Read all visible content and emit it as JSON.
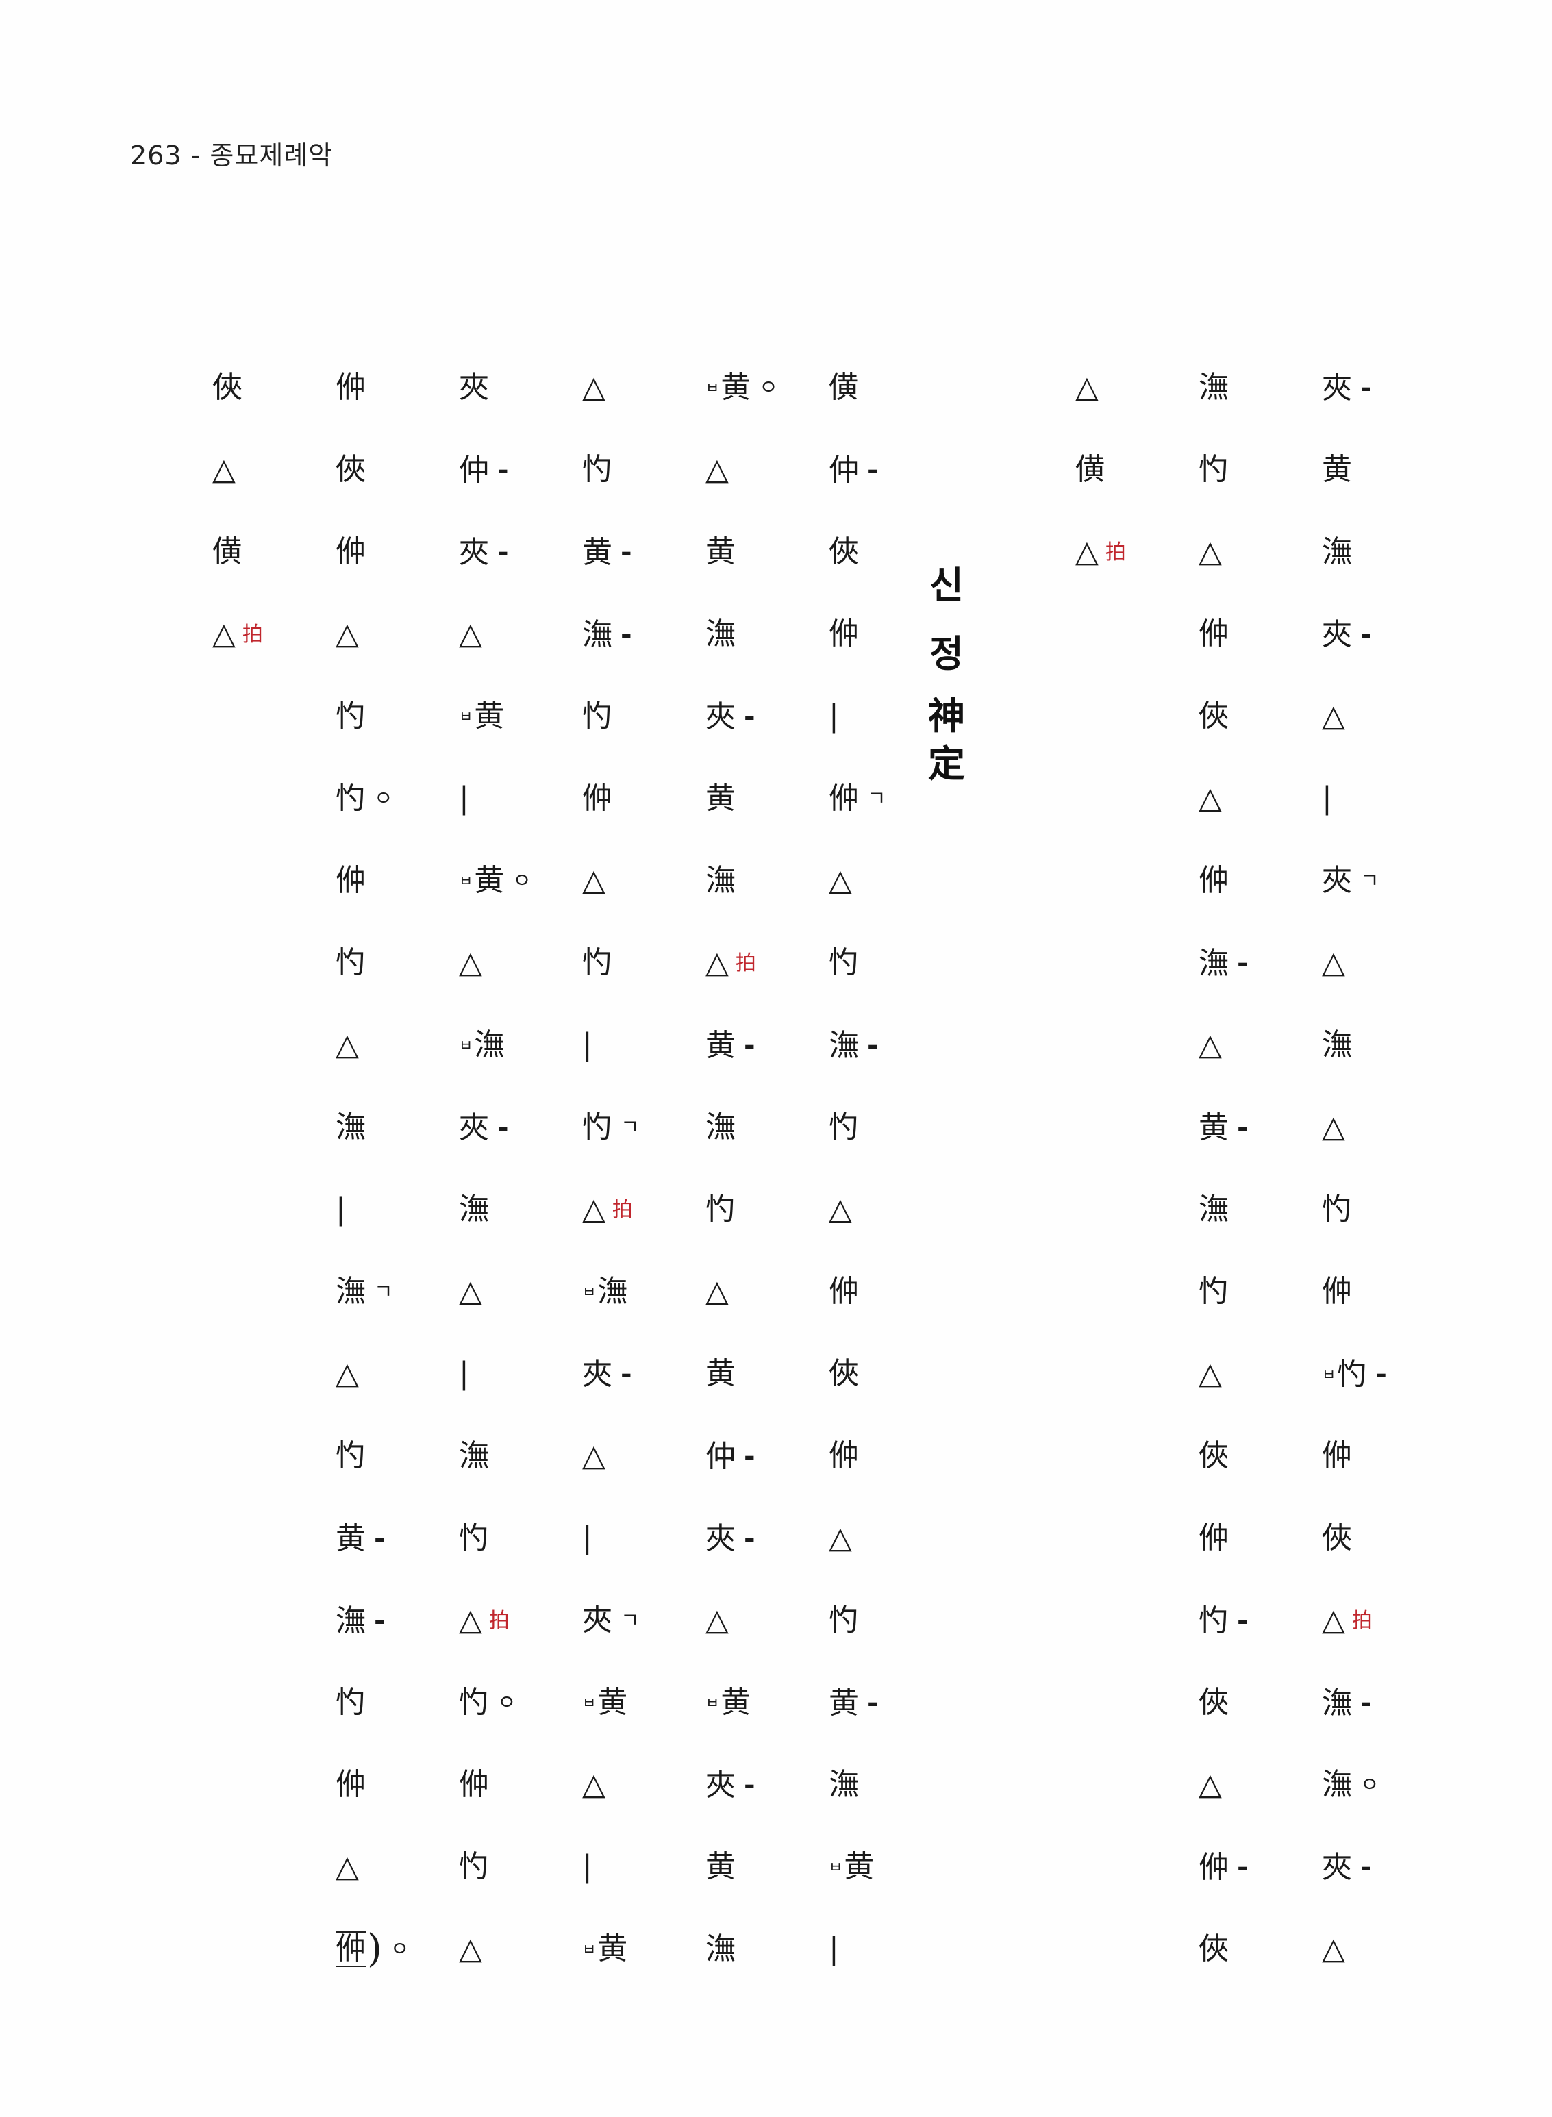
{
  "header": {
    "text": "263 - 종묘제례악"
  },
  "title": {
    "korean": [
      "신",
      "정"
    ],
    "hanja": [
      "神",
      "定"
    ]
  },
  "columns": [
    {
      "cells": [
        {
          "c": "俠"
        },
        {
          "c": "△"
        },
        {
          "c": "僙"
        },
        {
          "c": "△",
          "k": "拍"
        }
      ]
    },
    {
      "cells": [
        {
          "c": "㑖"
        },
        {
          "c": "俠"
        },
        {
          "c": "㑖"
        },
        {
          "c": "△"
        },
        {
          "c": "㣿"
        },
        {
          "c": "㣿",
          "s": "ㅇ"
        },
        {
          "c": "㑖"
        },
        {
          "c": "㣿"
        },
        {
          "c": "△"
        },
        {
          "c": "潕"
        },
        {
          "c": "|"
        },
        {
          "c": "潕",
          "s": "ㄱ"
        },
        {
          "c": "△"
        },
        {
          "c": "㣿"
        },
        {
          "c": "黄",
          "s": "-"
        },
        {
          "c": "潕",
          "s": "-"
        },
        {
          "c": "㣿"
        },
        {
          "c": "㑖"
        },
        {
          "c": "△"
        },
        {
          "c": "㑖",
          "m": true,
          "s": "ㅇ"
        }
      ]
    },
    {
      "cells": [
        {
          "c": "夾"
        },
        {
          "c": "仲",
          "s": "-"
        },
        {
          "c": "夾",
          "s": "-"
        },
        {
          "c": "△"
        },
        {
          "c": "黄",
          "p": "ㅂ"
        },
        {
          "c": "|"
        },
        {
          "c": "黄",
          "p": "ㅂ",
          "s": "ㅇ"
        },
        {
          "c": "△"
        },
        {
          "c": "潕",
          "p": "ㅂ"
        },
        {
          "c": "夾",
          "s": "-"
        },
        {
          "c": "潕"
        },
        {
          "c": "△"
        },
        {
          "c": "|"
        },
        {
          "c": "潕"
        },
        {
          "c": "㣿"
        },
        {
          "c": "△",
          "k": "拍"
        },
        {
          "c": "㣿",
          "s": "ㅇ"
        },
        {
          "c": "㑖"
        },
        {
          "c": "㣿"
        },
        {
          "c": "△"
        }
      ]
    },
    {
      "cells": [
        {
          "c": "△"
        },
        {
          "c": "㣿"
        },
        {
          "c": "黄",
          "s": "-"
        },
        {
          "c": "潕",
          "s": "-"
        },
        {
          "c": "㣿"
        },
        {
          "c": "㑖"
        },
        {
          "c": "△"
        },
        {
          "c": "㣿"
        },
        {
          "c": "|"
        },
        {
          "c": "㣿",
          "s": "ㄱ"
        },
        {
          "c": "△",
          "k": "拍"
        },
        {
          "c": "潕",
          "p": "ㅂ"
        },
        {
          "c": "夾",
          "s": "-"
        },
        {
          "c": "△"
        },
        {
          "c": "|"
        },
        {
          "c": "夾",
          "s": "ㄱ"
        },
        {
          "c": "黄",
          "p": "ㅂ"
        },
        {
          "c": "△"
        },
        {
          "c": "|"
        },
        {
          "c": "黄",
          "p": "ㅂ"
        }
      ]
    },
    {
      "cells": [
        {
          "c": "黄",
          "p": "ㅂ",
          "s": "ㅇ"
        },
        {
          "c": "△"
        },
        {
          "c": "黄"
        },
        {
          "c": "潕"
        },
        {
          "c": "夾",
          "s": "-"
        },
        {
          "c": "黄"
        },
        {
          "c": "潕"
        },
        {
          "c": "△",
          "k": "拍"
        },
        {
          "c": "黄",
          "s": "-"
        },
        {
          "c": "潕"
        },
        {
          "c": "㣿"
        },
        {
          "c": "△"
        },
        {
          "c": "黄"
        },
        {
          "c": "仲",
          "s": "-"
        },
        {
          "c": "夾",
          "s": "-"
        },
        {
          "c": "△"
        },
        {
          "c": "黄",
          "p": "ㅂ"
        },
        {
          "c": "夾",
          "s": "-"
        },
        {
          "c": "黄"
        },
        {
          "c": "潕"
        }
      ]
    },
    {
      "cells": [
        {
          "c": "僙"
        },
        {
          "c": "仲",
          "s": "-"
        },
        {
          "c": "俠"
        },
        {
          "c": "㑖"
        },
        {
          "c": "|"
        },
        {
          "c": "㑖",
          "s": "ㄱ"
        },
        {
          "c": "△"
        },
        {
          "c": "㣿"
        },
        {
          "c": "潕",
          "s": "-"
        },
        {
          "c": "㣿"
        },
        {
          "c": "△"
        },
        {
          "c": "㑖"
        },
        {
          "c": "俠"
        },
        {
          "c": "㑖"
        },
        {
          "c": "△"
        },
        {
          "c": "㣿"
        },
        {
          "c": "黄",
          "s": "-"
        },
        {
          "c": "潕"
        },
        {
          "c": "黄",
          "p": "ㅂ"
        },
        {
          "c": "|"
        }
      ]
    },
    {
      "cells": [
        {
          "c": "△"
        },
        {
          "c": "僙"
        },
        {
          "c": "△",
          "k": "拍"
        }
      ]
    },
    {
      "cells": [
        {
          "c": "潕"
        },
        {
          "c": "㣿"
        },
        {
          "c": "△"
        },
        {
          "c": "㑖"
        },
        {
          "c": "俠"
        },
        {
          "c": "△"
        },
        {
          "c": "㑖"
        },
        {
          "c": "潕",
          "s": "-"
        },
        {
          "c": "△"
        },
        {
          "c": "黄",
          "s": "-"
        },
        {
          "c": "潕"
        },
        {
          "c": "㣿"
        },
        {
          "c": "△"
        },
        {
          "c": "俠"
        },
        {
          "c": "㑖"
        },
        {
          "c": "㣿",
          "s": "-"
        },
        {
          "c": "俠"
        },
        {
          "c": "△"
        },
        {
          "c": "㑖",
          "s": "-"
        },
        {
          "c": "俠"
        }
      ]
    },
    {
      "cells": [
        {
          "c": "夾",
          "s": "-"
        },
        {
          "c": "黄"
        },
        {
          "c": "潕"
        },
        {
          "c": "夾",
          "s": "-"
        },
        {
          "c": "△"
        },
        {
          "c": "|"
        },
        {
          "c": "夾",
          "s": "ㄱ"
        },
        {
          "c": "△"
        },
        {
          "c": "潕"
        },
        {
          "c": "△"
        },
        {
          "c": "㣿"
        },
        {
          "c": "㑖"
        },
        {
          "c": "㣿",
          "p": "ㅂ",
          "s": "-"
        },
        {
          "c": "㑖"
        },
        {
          "c": "俠"
        },
        {
          "c": "△",
          "k": "拍"
        },
        {
          "c": "潕",
          "s": "-"
        },
        {
          "c": "潕",
          "s": "ㅇ"
        },
        {
          "c": "夾",
          "s": "-"
        },
        {
          "c": "△"
        }
      ]
    }
  ]
}
